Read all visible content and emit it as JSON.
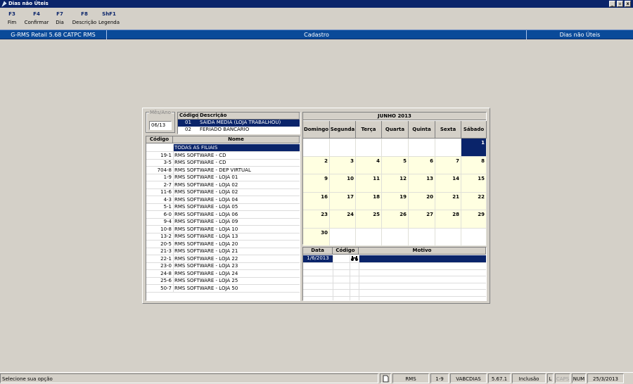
{
  "window": {
    "title": "Dias não Úteis",
    "minimize": "_",
    "maximize": "▫",
    "close": "x"
  },
  "toolbar": [
    {
      "key": "F3",
      "label": "Fim"
    },
    {
      "key": "F4",
      "label": "Confirmar"
    },
    {
      "key": "F7",
      "label": "Dia"
    },
    {
      "key": "F8",
      "label": "Descrição"
    },
    {
      "key": "ShF1",
      "label": "Legenda"
    }
  ],
  "header": {
    "app": "G-RMS Retail 5.68 CATPC RMS",
    "section": "Cadastro",
    "screen": "Dias não Úteis"
  },
  "mes_ano": {
    "legend": "Mês/Ano",
    "value": "06/13"
  },
  "codigo_table": {
    "headers": [
      "Código",
      "Descrição"
    ],
    "rows": [
      {
        "codigo": "01",
        "descricao": "SAIDA MÉDIA (LOJA TRABALHOU)"
      },
      {
        "codigo": "02",
        "descricao": "FERIADO BANCARIO"
      }
    ]
  },
  "filiais_table": {
    "headers": [
      "Código",
      "Nome"
    ],
    "rows": [
      {
        "codigo": "",
        "nome": "TODAS AS FILIAIS"
      },
      {
        "codigo": "19-1",
        "nome": "RMS SOFTWARE  -  CD"
      },
      {
        "codigo": "3-5",
        "nome": "RMS SOFTWARE - CD"
      },
      {
        "codigo": "704-8",
        "nome": "RMS SOFTWARE - DEP VIRTUAL"
      },
      {
        "codigo": "1-9",
        "nome": "RMS SOFTWARE - LOJA 01"
      },
      {
        "codigo": "2-7",
        "nome": "RMS SOFTWARE - LOJA 02"
      },
      {
        "codigo": "11-6",
        "nome": "RMS SOFTWARE - LOJA 02"
      },
      {
        "codigo": "4-3",
        "nome": "RMS SOFTWARE - LOJA 04"
      },
      {
        "codigo": "5-1",
        "nome": "RMS SOFTWARE - LOJA 05"
      },
      {
        "codigo": "6-0",
        "nome": "RMS SOFTWARE - LOJA 06"
      },
      {
        "codigo": "9-4",
        "nome": "RMS SOFTWARE - LOJA 09"
      },
      {
        "codigo": "10-8",
        "nome": "RMS SOFTWARE - LOJA 10"
      },
      {
        "codigo": "13-2",
        "nome": "RMS SOFTWARE - LOJA 13"
      },
      {
        "codigo": "20-5",
        "nome": "RMS SOFTWARE - LOJA 20"
      },
      {
        "codigo": "21-3",
        "nome": "RMS SOFTWARE - LOJA 21"
      },
      {
        "codigo": "22-1",
        "nome": "RMS SOFTWARE - LOJA 22"
      },
      {
        "codigo": "23-0",
        "nome": "RMS SOFTWARE - LOJA 23"
      },
      {
        "codigo": "24-8",
        "nome": "RMS SOFTWARE - LOJA 24"
      },
      {
        "codigo": "25-6",
        "nome": "RMS SOFTWARE - LOJA 25"
      },
      {
        "codigo": "50-7",
        "nome": "RMS SOFTWARE - LOJA 50"
      }
    ]
  },
  "calendar": {
    "title": "JUNHO 2013",
    "weekdays": [
      "Domingo",
      "Segunda",
      "Terça",
      "Quarta",
      "Quinta",
      "Sexta",
      "Sábado"
    ],
    "weeks": [
      [
        "",
        "",
        "",
        "",
        "",
        "",
        "1"
      ],
      [
        "2",
        "3",
        "4",
        "5",
        "6",
        "7",
        "8"
      ],
      [
        "9",
        "10",
        "11",
        "12",
        "13",
        "14",
        "15"
      ],
      [
        "16",
        "17",
        "18",
        "19",
        "20",
        "21",
        "22"
      ],
      [
        "23",
        "24",
        "25",
        "26",
        "27",
        "28",
        "29"
      ],
      [
        "30",
        "",
        "",
        "",
        "",
        "",
        ""
      ]
    ],
    "selected_day": "1"
  },
  "motivo_table": {
    "headers": [
      "Data",
      "Código",
      "Motivo"
    ],
    "rows": [
      {
        "data": "1/6/2013",
        "codigo": "",
        "motivo": ""
      }
    ]
  },
  "status": {
    "message": "Selecione sua opção",
    "module": "RMS",
    "filial": "1-9",
    "program": "VABCDIAS",
    "version": "5.67.1",
    "mode": "Inclusão",
    "l": "L",
    "caps": "CAPS",
    "num": "NUM",
    "date": "25/3/2013"
  },
  "colors": {
    "navy": "#0a246a",
    "header_blue": "#0a4a99",
    "calendar_yellow": "#ffffe1",
    "background": "#d4d0c8"
  },
  "icons": {
    "app": "dias-app-icon",
    "binoculars": "binoculars-icon",
    "document": "document-icon"
  }
}
